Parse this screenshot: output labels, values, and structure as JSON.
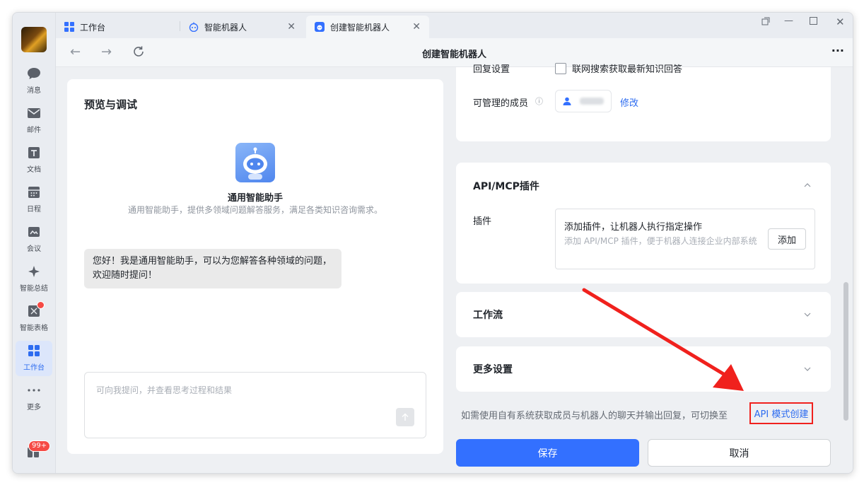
{
  "tabs": [
    {
      "label": "工作台",
      "icon": "grid-icon"
    },
    {
      "label": "智能机器人",
      "icon": "robot-icon"
    },
    {
      "label": "创建智能机器人",
      "icon": "robot-icon"
    }
  ],
  "navbar": {
    "title": "创建智能机器人",
    "more": "···"
  },
  "rail": {
    "items": [
      {
        "label": "消息",
        "icon": "chat-bubble-icon"
      },
      {
        "label": "邮件",
        "icon": "mail-icon"
      },
      {
        "label": "文档",
        "icon": "document-icon"
      },
      {
        "label": "日程",
        "icon": "calendar-icon"
      },
      {
        "label": "会议",
        "icon": "meeting-icon"
      },
      {
        "label": "智能总结",
        "icon": "sparkle-icon"
      },
      {
        "label": "智能表格",
        "icon": "smart-sheet-icon"
      },
      {
        "label": "工作台",
        "icon": "workbench-grid-icon"
      },
      {
        "label": "更多",
        "icon": "more-dots-icon"
      }
    ],
    "badge": "99+"
  },
  "preview": {
    "title": "预览与调试",
    "bot_name": "通用智能助手",
    "bot_desc": "通用智能助手，提供多领域问题解答服务，满足各类知识咨询需求。",
    "greeting": "您好！我是通用智能助手，可以为您解答各种领域的问题，欢迎随时提问！",
    "input_placeholder": "可向我提问，并查看思考过程和结果"
  },
  "settings": {
    "reply_label": "回复设置",
    "reply_option": "联网搜索获取最新知识回答",
    "members_label": "可管理的成员",
    "members_edit": "修改"
  },
  "plugins": {
    "title": "API/MCP插件",
    "label": "插件",
    "box_title": "添加插件，让机器人执行指定操作",
    "box_desc": "添加 API/MCP 插件，便于机器人连接企业内部系统",
    "add_button": "添加"
  },
  "workflow": {
    "title": "工作流"
  },
  "more_settings": {
    "title": "更多设置"
  },
  "api_hint": {
    "text": "如需使用自有系统获取成员与机器人的聊天并输出回复，可切换至",
    "link": "API 模式创建"
  },
  "actions": {
    "save": "保存",
    "cancel": "取消"
  },
  "colors": {
    "accent": "#3370ff",
    "highlight": "#f0211d"
  }
}
